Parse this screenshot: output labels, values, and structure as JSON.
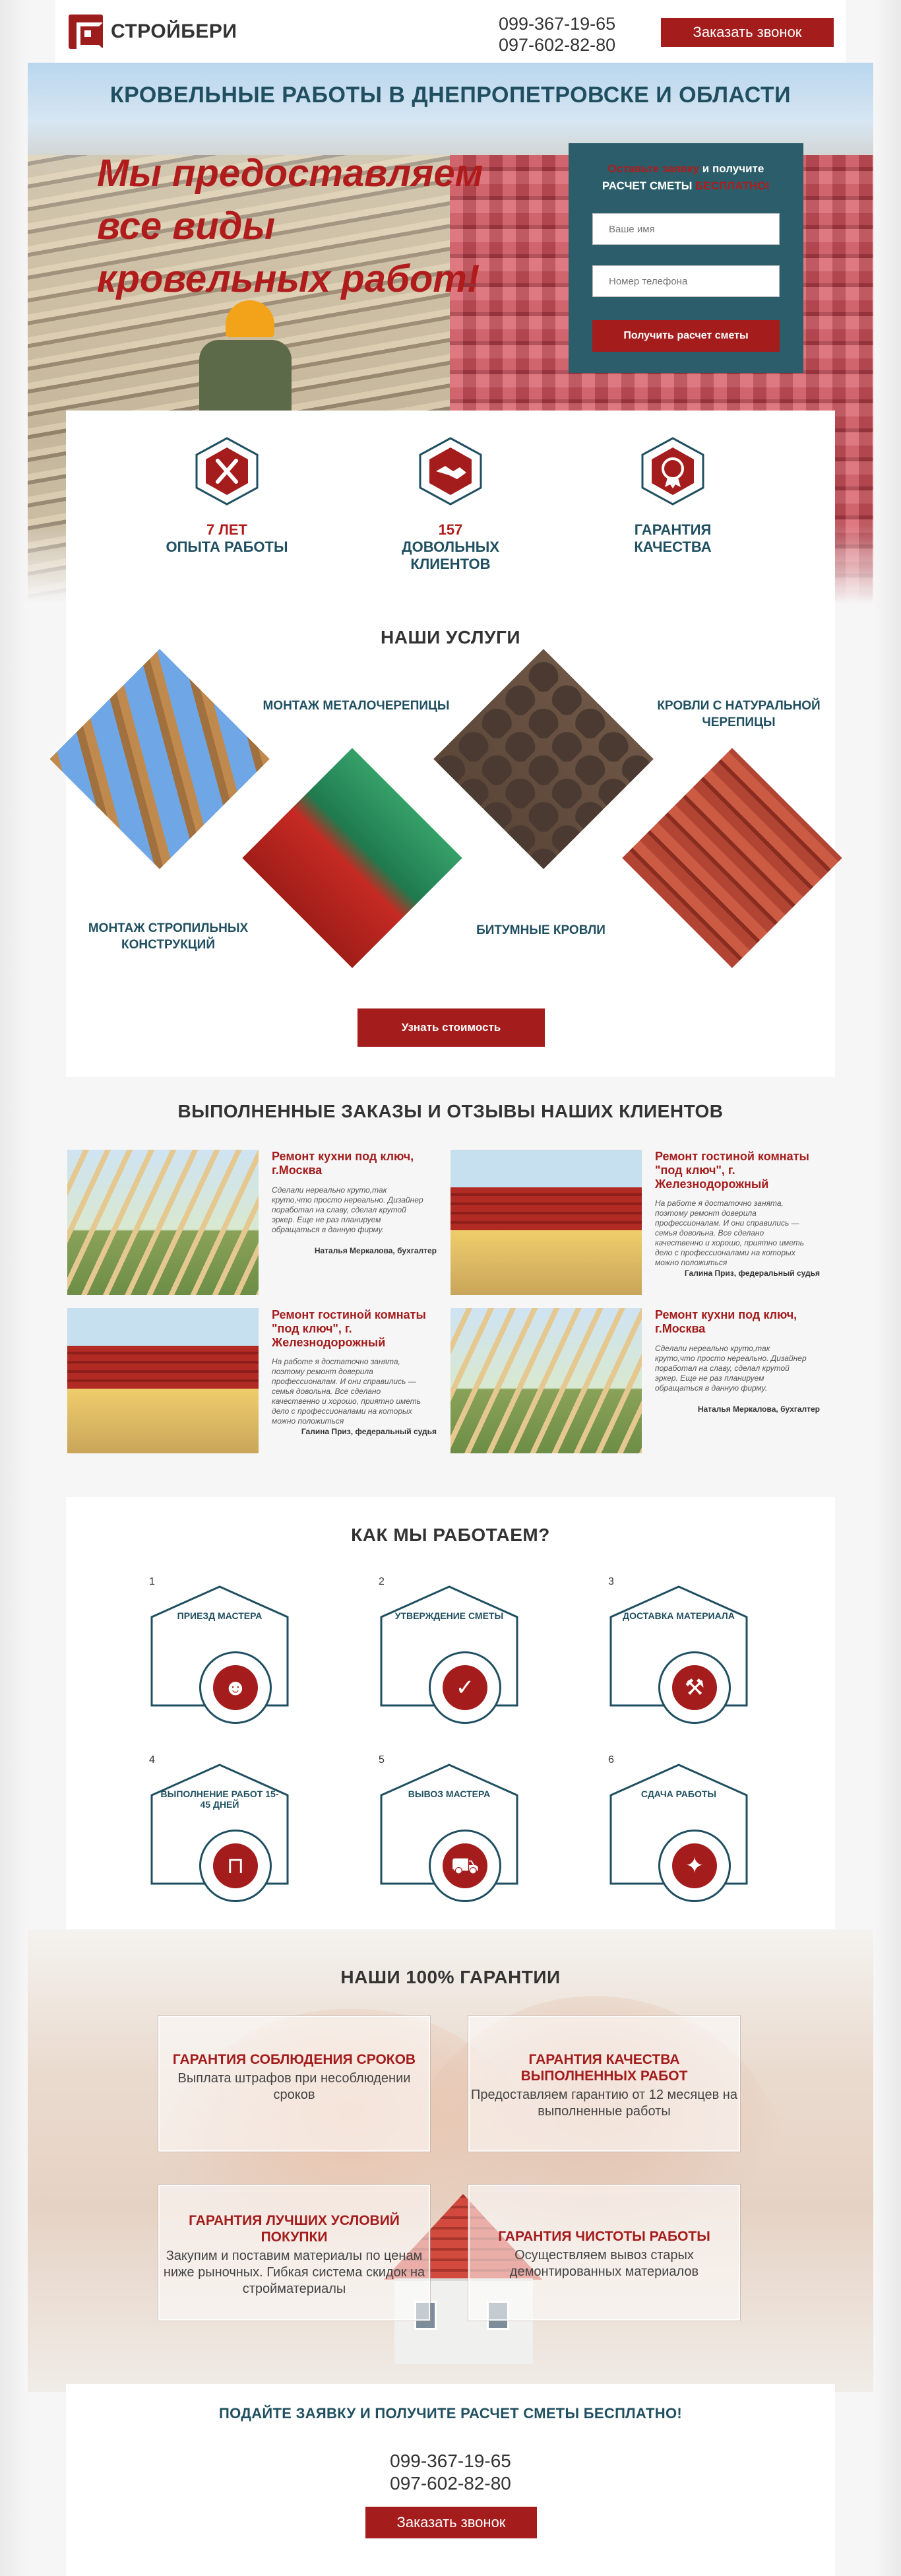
{
  "header": {
    "logo_text": "СТРОЙБЕРИ",
    "phone_1": "099-367-19-65",
    "phone_2": "097-602-82-80",
    "call_button": "Заказать звонок"
  },
  "hero": {
    "title": "КРОВЕЛЬНЫЕ РАБОТЫ В ДНЕПРОПЕТРОВСКЕ И ОБЛАСТИ",
    "slogan_line_1": "Мы предоставляем",
    "slogan_line_2": "все виды",
    "slogan_line_3": "кровельных работ!",
    "form": {
      "head_part_1": "Оставьте заявку",
      "head_part_2": " и получите",
      "head_line_2_part_1": "РАСЧЕТ СМЕТЫ ",
      "head_line_2_part_2": "БЕСПЛАТНО!",
      "name_placeholder": "Ваше имя",
      "phone_placeholder": "Номер телефона",
      "submit": "Получить расчет сметы"
    }
  },
  "stats": [
    {
      "num": "7 ЛЕТ",
      "label": "ОПЫТА РАБОТЫ",
      "icon": "tools-icon"
    },
    {
      "num": "157",
      "label": "ДОВОЛЬНЫХ КЛИЕНТОВ",
      "icon": "handshake-icon"
    },
    {
      "num": "ГАРАНТИЯ",
      "label": "КАЧЕСТВА",
      "icon": "medal-icon"
    }
  ],
  "services": {
    "title": "НАШИ УСЛУГИ",
    "items": [
      "МОНТАЖ СТРОПИЛЬНЫХ КОНСТРУКЦИЙ",
      "МОНТАЖ МЕТАЛОЧЕРЕПИЦЫ",
      "БИТУМНЫЕ КРОВЛИ",
      "КРОВЛИ С НАТУРАЛЬНОЙ ЧЕРЕПИЦЫ"
    ],
    "items_split": {
      "s1_l1": "МОНТАЖ СТРОПИЛЬНЫХ",
      "s1_l2": "КОНСТРУКЦИЙ",
      "s2_l1": "МОНТАЖ МЕТАЛОЧЕРЕПИЦЫ",
      "s3_l1": "БИТУМНЫЕ КРОВЛИ",
      "s4_l1": "КРОВЛИ С НАТУРАЛЬНОЙ",
      "s4_l2": "ЧЕРЕПИЦЫ"
    },
    "button": "Узнать стоимость"
  },
  "orders": {
    "title": "ВЫПОЛНЕННЫЕ ЗАКАЗЫ И ОТЗЫВЫ НАШИХ КЛИЕНТОВ",
    "items": [
      {
        "title": "Ремонт кухни под ключ, г.Москва",
        "text": "Сделали нереально круто,так круто,что просто нереально. Дизайнер поработал на славу, сделал крутой эркер. Еще не раз планируем обращаться в данную фирму.",
        "author": "Наталья Меркалова, бухгалтер"
      },
      {
        "title": "Ремонт гостиной комнаты \"под ключ\", г. Железнодорожный",
        "text": "На работе я достаточно занята, поэтому ремонт доверила профессионалам. И они справились — семья довольна. Все сделано качественно и хорошо, приятно иметь дело с профессионалами на которых можно положиться",
        "author": "Галина Приз, федеральный судья"
      },
      {
        "title": "Ремонт гостиной комнаты \"под ключ\", г. Железнодорожный",
        "text": "На работе я достаточно занята, поэтому ремонт доверила профессионалам. И они справились — семья довольна. Все сделано качественно и хорошо, приятно иметь дело с профессионалами на которых можно положиться",
        "author": "Галина Приз, федеральный судья"
      },
      {
        "title": "Ремонт кухни под ключ, г.Москва",
        "text": "Сделали нереально круто,так круто,что просто нереально. Дизайнер поработал на славу, сделал крутой эркер. Еще не раз планируем обращаться в данную фирму.",
        "author": "Наталья Меркалова, бухгалтер"
      }
    ]
  },
  "how": {
    "title": "КАК МЫ РАБОТАЕМ?",
    "steps": [
      {
        "num": "1",
        "label": "ПРИЕЗД МАСТЕРА",
        "icon": "worker-icon"
      },
      {
        "num": "2",
        "label": "УТВЕРЖДЕНИЕ СМЕТЫ",
        "icon": "checklist-icon"
      },
      {
        "num": "3",
        "label": "ДОСТАВКА МАТЕРИАЛА",
        "icon": "toolbox-icon"
      },
      {
        "num": "4",
        "label": "ВЫПОЛНЕНИЕ РАБОТ 15-45 ДНЕЙ",
        "icon": "paint-roller-icon"
      },
      {
        "num": "5",
        "label": "ВЫВОЗ МАСТЕРА",
        "icon": "cart-icon"
      },
      {
        "num": "6",
        "label": "СДАЧА РАБОТЫ",
        "icon": "handshake-icon"
      }
    ]
  },
  "guarantees": {
    "title": "НАШИ 100% ГАРАНТИИ",
    "items": [
      {
        "title": "ГАРАНТИЯ СОБЛЮДЕНИЯ СРОКОВ",
        "text": "Выплата штрафов при несоблюдении сроков"
      },
      {
        "title": "ГАРАНТИЯ КАЧЕСТВА ВЫПОЛНЕННЫХ РАБОТ",
        "text": "Предоставляем гарантию от 12 месяцев на выполненные работы"
      },
      {
        "title": "ГАРАНТИЯ ЛУЧШИХ УСЛОВИЙ ПОКУПКИ",
        "text": "Закупим и поставим материалы по ценам ниже рыночных. Гибкая система скидок на стройматериалы"
      },
      {
        "title": "ГАРАНТИЯ ЧИСТОТЫ РАБОТЫ",
        "text": "Осуществляем вывоз старых демонтированных материалов"
      }
    ]
  },
  "cta": {
    "title": "ПОДАЙТЕ ЗАЯВКУ И ПОЛУЧИТЕ РАСЧЕТ СМЕТЫ БЕСПЛАТНО!",
    "phone_1": "099-367-19-65",
    "phone_2": "097-602-82-80",
    "button": "Заказать звонок"
  },
  "colors": {
    "accent_red": "#a41c1c",
    "dark_teal": "#1f4f60",
    "form_teal": "#2b5e6a"
  }
}
